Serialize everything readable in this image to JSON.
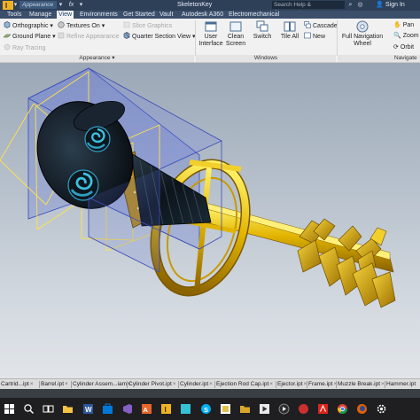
{
  "titlebar": {
    "quick_access": "Appearance",
    "document_title": "SkeletonKey",
    "search_placeholder": "Search Help & Commands...",
    "sign_in": "Sign In"
  },
  "ribbon_tabs": [
    {
      "label": "Tools",
      "active": false
    },
    {
      "label": "Manage",
      "active": false
    },
    {
      "label": "View",
      "active": true
    },
    {
      "label": "Environments",
      "active": false
    },
    {
      "label": "Get Started",
      "active": false
    },
    {
      "label": "Vault",
      "active": false
    },
    {
      "label": "Autodesk A360",
      "active": false
    },
    {
      "label": "Electromechanical",
      "active": false
    }
  ],
  "appearance_panel": {
    "title": "Appearance",
    "orthographic": "Orthographic",
    "textures_on": "Textures On",
    "ground_plane": "Ground Plane",
    "refine_appearance": "Refine Appearance",
    "ray_tracing": "Ray Tracing",
    "slice_graphics": "Slice Graphics",
    "quarter_section_view": "Quarter Section View"
  },
  "windows_panel": {
    "title": "Windows",
    "user_interface": [
      "User",
      "Interface"
    ],
    "clean_screen": [
      "Clean",
      "Screen"
    ],
    "switch": "Switch",
    "tile_all": "Tile All",
    "cascade": "Cascade",
    "new": "New"
  },
  "navigate_panel": {
    "title": "Navigate",
    "full_navigation_wheel": [
      "Full Navigation",
      "Wheel"
    ],
    "pan": "Pan",
    "zoom": "Zoom",
    "orbit": "Orbit"
  },
  "document_tabs": [
    "Cartrid...ipt",
    "Barrel.ipt",
    "Cylinder Assem...iam",
    "Cylinder Pivot.ipt",
    "Cylinder.ipt",
    "Ejection Rod Cap.ipt",
    "Ejector.ipt",
    "Frame.ipt",
    "Muzzle Break.ipt",
    "Hammer.ipt"
  ],
  "colors": {
    "ribbon_bg": "#f1f1f1",
    "titlebar_bg": "#2e3f58",
    "key_gold": "#e2b400",
    "handle_dark": "#121c24",
    "spiral_cyan": "#2f9fc0",
    "selection_blue": "#5a6fd8"
  },
  "taskbar_icons": [
    "windows-start-icon",
    "search-icon",
    "task-view-icon",
    "file-explorer-icon",
    "word-icon",
    "store-icon",
    "visual-studio-icon",
    "photoshop-icon",
    "inventor-icon",
    "autodesk-icon",
    "skype-icon",
    "app-icon",
    "folder-icon",
    "media-icon",
    "pdf-icon",
    "chrome-icon",
    "firefox-icon",
    "settings-icon"
  ]
}
